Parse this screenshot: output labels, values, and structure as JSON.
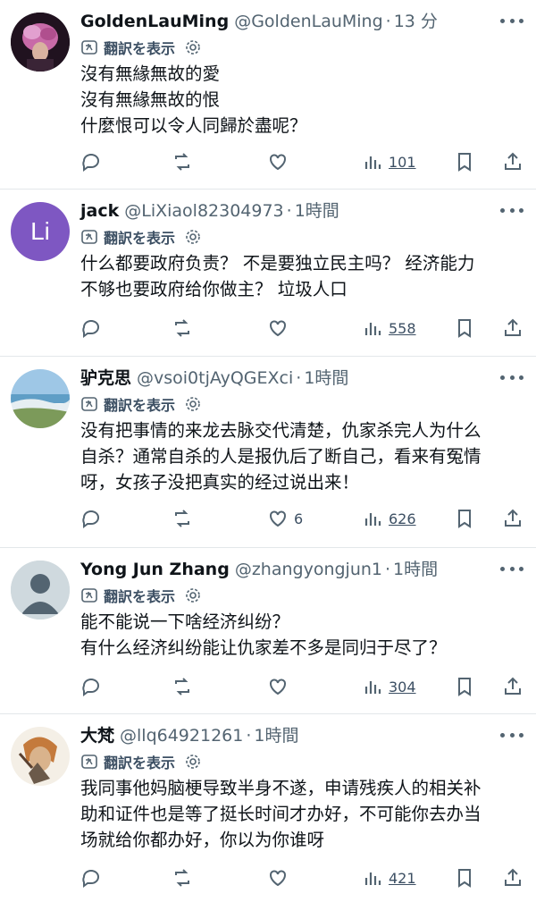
{
  "translate_label": "翻訳を表示",
  "tweets": [
    {
      "name": "GoldenLauMing",
      "handle": "@GoldenLauMing",
      "time": "13 分",
      "lines": [
        "沒有無緣無故的愛",
        "沒有無緣無故的恨",
        "什麼恨可以令人同歸於盡呢？"
      ],
      "likes": "",
      "views": "101",
      "avatar": "portrait-purple"
    },
    {
      "name": "jack",
      "handle": "@LiXiaol82304973",
      "time": "1時間",
      "lines": [
        "什么都要政府负责？ 不是要独立民主吗？ 经济能力",
        "不够也要政府给你做主？  垃圾人口"
      ],
      "likes": "",
      "views": "558",
      "avatar": "Li",
      "avatar_color": "#7e57c2"
    },
    {
      "name": "驴克思",
      "handle": "@vsoi0tjAyQGEXci",
      "time": "1時間",
      "lines": [
        "没有把事情的来龙去脉交代清楚，仇家杀完人为什么",
        "自杀？通常自杀的人是报仇后了断自己，看来有冤情",
        "呀，女孩子没把真实的经过说出来！"
      ],
      "likes": "6",
      "views": "626",
      "avatar": "beach"
    },
    {
      "name": "Yong Jun Zhang",
      "handle": "@zhangyongjun1",
      "time": "1時間",
      "lines": [
        "能不能说一下啥经济纠纷？",
        "有什么经济纠纷能让仇家差不多是同归于尽了？"
      ],
      "likes": "",
      "views": "304",
      "avatar": "default"
    },
    {
      "name": "大梵",
      "handle": "@llq64921261",
      "time": "1時間",
      "lines": [
        "我同事他妈脑梗导致半身不遂，申请残疾人的相关补",
        "助和证件也是等了挺长时间才办好，不可能你去办当",
        "场就给你都办好，你以为你谁呀"
      ],
      "likes": "",
      "views": "421",
      "avatar": "sketch"
    }
  ]
}
